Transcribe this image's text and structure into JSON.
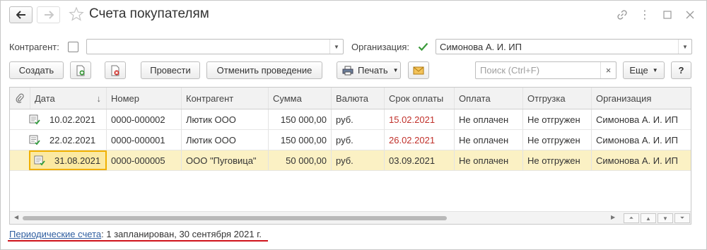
{
  "window": {
    "title": "Счета покупателям"
  },
  "filters": {
    "counterparty_label": "Контрагент:",
    "counterparty_value": "",
    "organization_label": "Организация:",
    "organization_value": "Симонова А. И. ИП"
  },
  "toolbar": {
    "create": "Создать",
    "post": "Провести",
    "cancel_post": "Отменить проведение",
    "print": "Печать",
    "search_placeholder": "Поиск (Ctrl+F)",
    "search_clear": "×",
    "more": "Еще",
    "help": "?"
  },
  "table": {
    "columns": [
      "Дата",
      "Номер",
      "Контрагент",
      "Сумма",
      "Валюта",
      "Срок оплаты",
      "Оплата",
      "Отгрузка",
      "Организация"
    ],
    "sort_indicator": "↓",
    "rows": [
      {
        "date": "10.02.2021",
        "number": "0000-000002",
        "counterparty": "Лютик ООО",
        "sum": "150 000,00",
        "currency": "руб.",
        "due": "15.02.2021",
        "payment": "Не оплачен",
        "shipment": "Не отгружен",
        "org": "Симонова А. И. ИП"
      },
      {
        "date": "22.02.2021",
        "number": "0000-000001",
        "counterparty": "Лютик ООО",
        "sum": "150 000,00",
        "currency": "руб.",
        "due": "26.02.2021",
        "payment": "Не оплачен",
        "shipment": "Не отгружен",
        "org": "Симонова А. И. ИП"
      },
      {
        "date": "31.08.2021",
        "number": "0000-000005",
        "counterparty": "ООО \"Пуговица\"",
        "sum": "50 000,00",
        "currency": "руб.",
        "due": "03.09.2021",
        "payment": "Не оплачен",
        "shipment": "Не отгружен",
        "org": "Симонова А. И. ИП"
      }
    ]
  },
  "footer": {
    "link": "Периодические счета",
    "text": ": 1 запланирован, 30 сентября 2021 г."
  },
  "colors": {
    "overdue": "#c0302a",
    "selected_row": "#fbf1c4",
    "focus_border": "#f0b000",
    "link": "#2f5ea0",
    "highlight_line": "#d0131b"
  }
}
